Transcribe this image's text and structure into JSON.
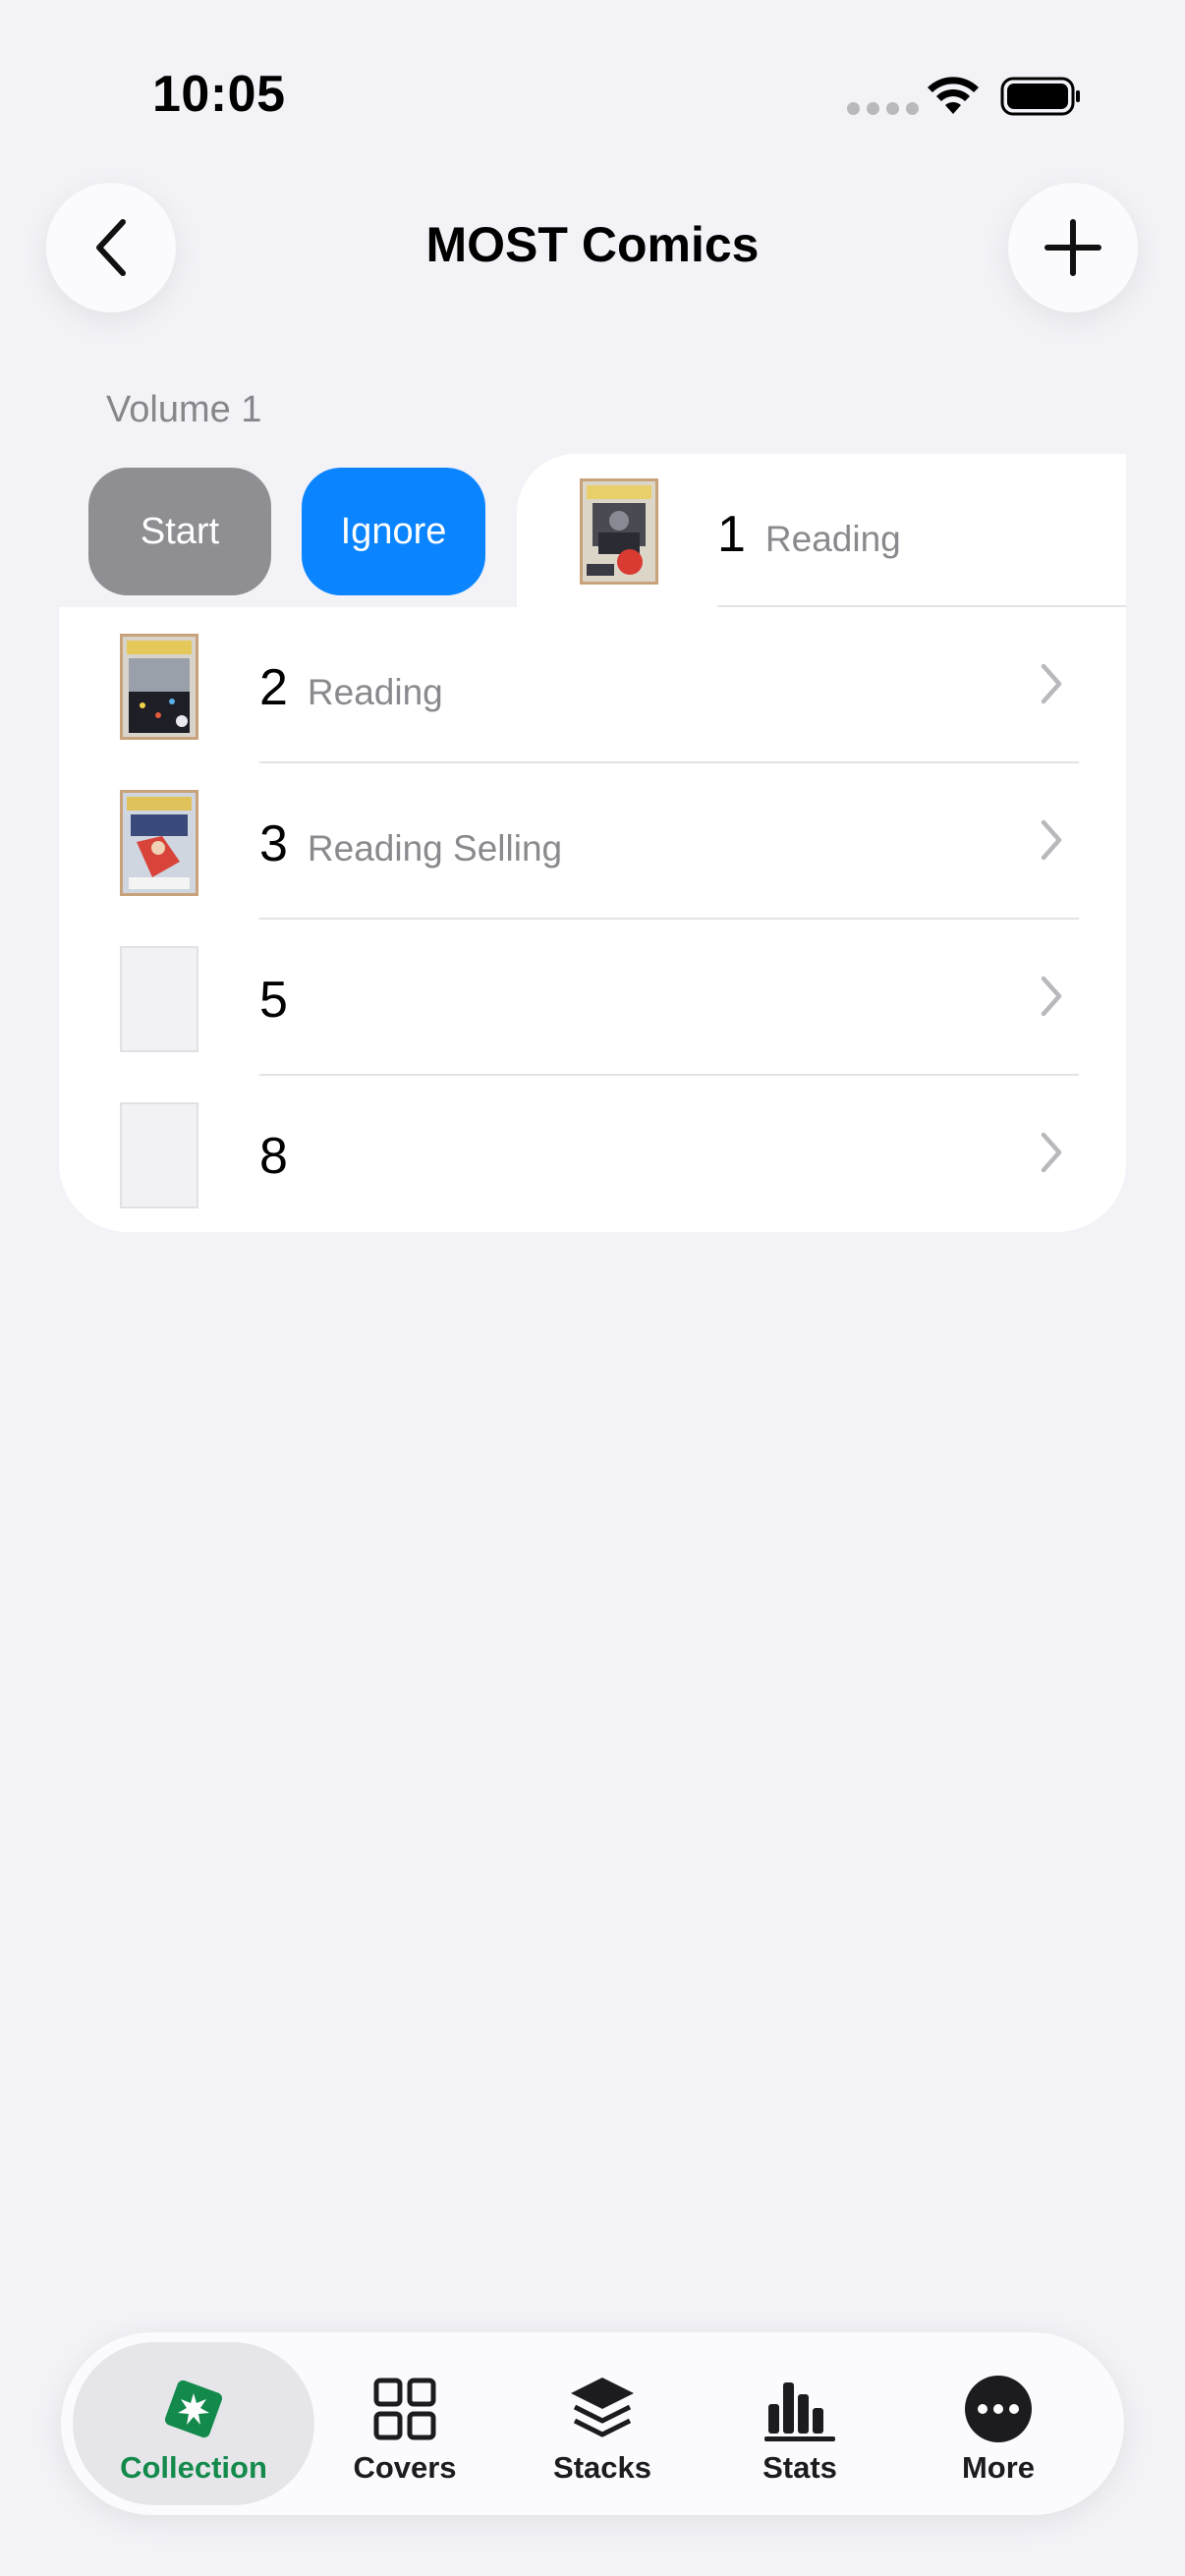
{
  "status_bar": {
    "time": "10:05"
  },
  "nav": {
    "title": "MOST Comics"
  },
  "section": {
    "header": "Volume 1"
  },
  "swipe_actions": {
    "start_label": "Start",
    "ignore_label": "Ignore"
  },
  "issues": [
    {
      "number": "1",
      "status": "Reading"
    },
    {
      "number": "2",
      "status": "Reading"
    },
    {
      "number": "3",
      "status": "Reading Selling"
    },
    {
      "number": "5",
      "status": ""
    },
    {
      "number": "8",
      "status": ""
    }
  ],
  "tabs": [
    {
      "label": "Collection",
      "icon": "collection-icon",
      "active": true
    },
    {
      "label": "Covers",
      "icon": "grid-icon"
    },
    {
      "label": "Stacks",
      "icon": "stack-icon"
    },
    {
      "label": "Stats",
      "icon": "chart-icon"
    },
    {
      "label": "More",
      "icon": "more-icon"
    }
  ],
  "colors": {
    "accent": "#138a4c",
    "ignore": "#0a84ff",
    "start": "#8e8e93",
    "background": "#f2f2f7"
  }
}
